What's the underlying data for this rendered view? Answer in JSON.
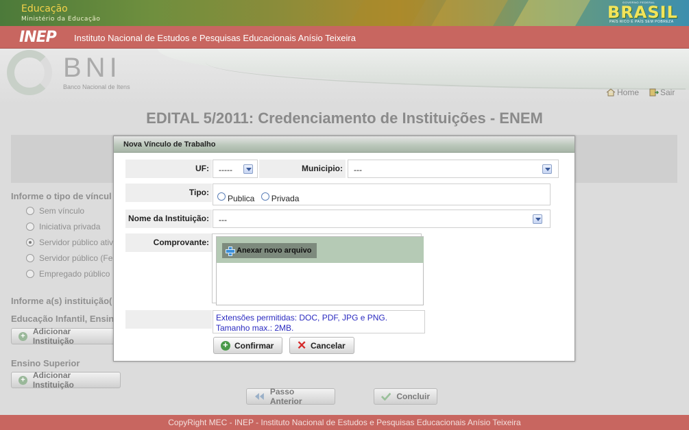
{
  "gov": {
    "title": "Educação",
    "subtitle": "Ministério da Educação",
    "brasil": "BRASIL",
    "brasil_top": "GOVERNO FEDERAL",
    "brasil_tag": "PAÍS RICO É PAÍS SEM POBREZA"
  },
  "inep": {
    "logo": "INEP",
    "name": "Instituto Nacional de Estudos e Pesquisas Educacionais Anísio Teixeira"
  },
  "bni": {
    "logo": "BNI",
    "subtitle": "Banco Nacional de Itens"
  },
  "nav": {
    "home": "Home",
    "exit": "Sair"
  },
  "page": {
    "title": "EDITAL 5/2011: Credenciamento de Instituições - ENEM"
  },
  "background_form": {
    "vinculo_label": "Informe o tipo de víncul",
    "options": [
      {
        "label": "Sem vínculo",
        "selected": false
      },
      {
        "label": "Iniciativa privada",
        "selected": false
      },
      {
        "label": "Servidor público ativ",
        "selected": true
      },
      {
        "label": "Servidor público (Fe",
        "selected": false
      },
      {
        "label": "Empregado público",
        "selected": false
      }
    ],
    "instituicao_label": "Informe a(s) instituição(",
    "educacao_label": "Educação Infantil, Ensin",
    "add_button_1": "Adicionar Instituição",
    "ensino_superior_label": "Ensino Superior",
    "add_button_2": "Adicionar Instituição",
    "prev_button": "Passo Anterior",
    "finish_button": "Concluir"
  },
  "modal": {
    "title": "Nova Vínculo de Trabalho",
    "uf_label": "UF:",
    "uf_value": "-----",
    "municipio_label": "Municipio:",
    "municipio_value": "---",
    "tipo_label": "Tipo:",
    "tipo_options": [
      "Publica",
      "Privada"
    ],
    "instituicao_label": "Nome da Instituição:",
    "instituicao_value": "---",
    "comprovante_label": "Comprovante:",
    "anexar_button": "Anexar novo arquivo",
    "info_line1": "Extensões permitidas: DOC, PDF, JPG e PNG.",
    "info_line2": "Tamanho max.: 2MB.",
    "confirm_button": "Confirmar",
    "cancel_button": "Cancelar"
  },
  "footer": {
    "text": "CopyRight MEC - INEP - Instituto Nacional de Estudos e Pesquisas Educacionais Anísio Teixeira"
  },
  "colors": {
    "accent_red": "#c86660",
    "link_blue": "#2a2ac0",
    "modal_header": "#b9c6b9"
  }
}
